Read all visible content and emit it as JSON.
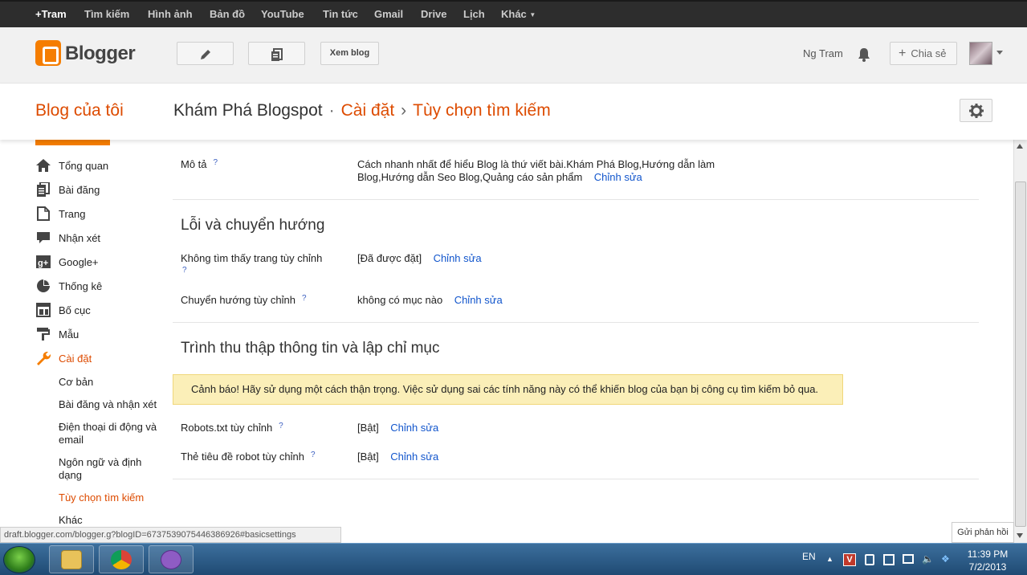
{
  "google_bar": {
    "items": [
      "+Tram",
      "Tìm kiếm",
      "Hình ảnh",
      "Bản đồ",
      "YouTube",
      "Tin tức",
      "Gmail",
      "Drive",
      "Lịch",
      "Khác"
    ]
  },
  "header": {
    "logo_text": "Blogger",
    "view_blog_label": "Xem blog",
    "user_name": "Ng Tram",
    "share_label": "Chia sẻ"
  },
  "titlebar": {
    "my_blogs": "Blog của tôi",
    "blog_name": "Khám Phá Blogspot",
    "dot": "·",
    "settings": "Cài đặt",
    "arrow": "›",
    "current": "Tùy chọn tìm kiếm"
  },
  "sidebar": {
    "items": [
      {
        "label": "Tổng quan",
        "icon": "home-icon"
      },
      {
        "label": "Bài đăng",
        "icon": "posts-icon"
      },
      {
        "label": "Trang",
        "icon": "page-icon"
      },
      {
        "label": "Nhận xét",
        "icon": "comment-icon"
      },
      {
        "label": "Google+",
        "icon": "google-plus-icon"
      },
      {
        "label": "Thống kê",
        "icon": "stats-icon"
      },
      {
        "label": "Bố cục",
        "icon": "layout-icon"
      },
      {
        "label": "Mẫu",
        "icon": "template-icon"
      },
      {
        "label": "Cài đặt",
        "icon": "wrench-icon"
      }
    ],
    "sub_items": [
      "Cơ bản",
      "Bài đăng và nhận xét",
      "Điện thoại di động và email",
      "Ngôn ngữ và định dạng",
      "Tùy chọn tìm kiếm",
      "Khác"
    ]
  },
  "main": {
    "description": {
      "label": "Mô tả",
      "help": "?",
      "line1": "Cách nhanh nhất để hiểu Blog là thứ viết bài.Khám Phá Blog,Hướng dẫn làm",
      "line2": "Blog,Hướng dẫn Seo Blog,Quảng cáo sản phẩm",
      "edit": "Chỉnh sửa"
    },
    "errors_section": {
      "title": "Lỗi và chuyển hướng",
      "not_found_label": "Không tìm thấy trang tùy chỉnh",
      "not_found_help": "?",
      "not_found_value": "[Đã được đặt]",
      "not_found_edit": "Chỉnh sửa",
      "redirect_label": "Chuyển hướng tùy chỉnh",
      "redirect_help": "?",
      "redirect_value": "không có mục nào",
      "redirect_edit": "Chỉnh sửa"
    },
    "crawl_section": {
      "title": "Trình thu thập thông tin và lập chỉ mục",
      "warning": "Cảnh báo! Hãy sử dụng một cách thận trọng. Việc sử dụng sai các tính năng này có thể khiến blog của bạn bị công cụ tìm kiếm bỏ qua.",
      "robots_label": "Robots.txt tùy chỉnh",
      "robots_help": "?",
      "robots_value": "[Bật]",
      "robots_edit": "Chỉnh sửa",
      "header_tags_label": "Thẻ tiêu đề robot tùy chỉnh",
      "header_tags_help": "?",
      "header_tags_value": "[Bật]",
      "header_tags_edit": "Chỉnh sửa"
    }
  },
  "status_url": "draft.blogger.com/blogger.g?blogID=6737539075446386926#basicsettings",
  "feedback_label": "Gửi phản hồi",
  "taskbar": {
    "language": "EN",
    "time": "11:39 PM",
    "date": "7/2/2013"
  },
  "colors": {
    "accent_orange": "#dd4b00",
    "link_blue": "#1155cc",
    "warning_bg": "#fbefb8"
  }
}
